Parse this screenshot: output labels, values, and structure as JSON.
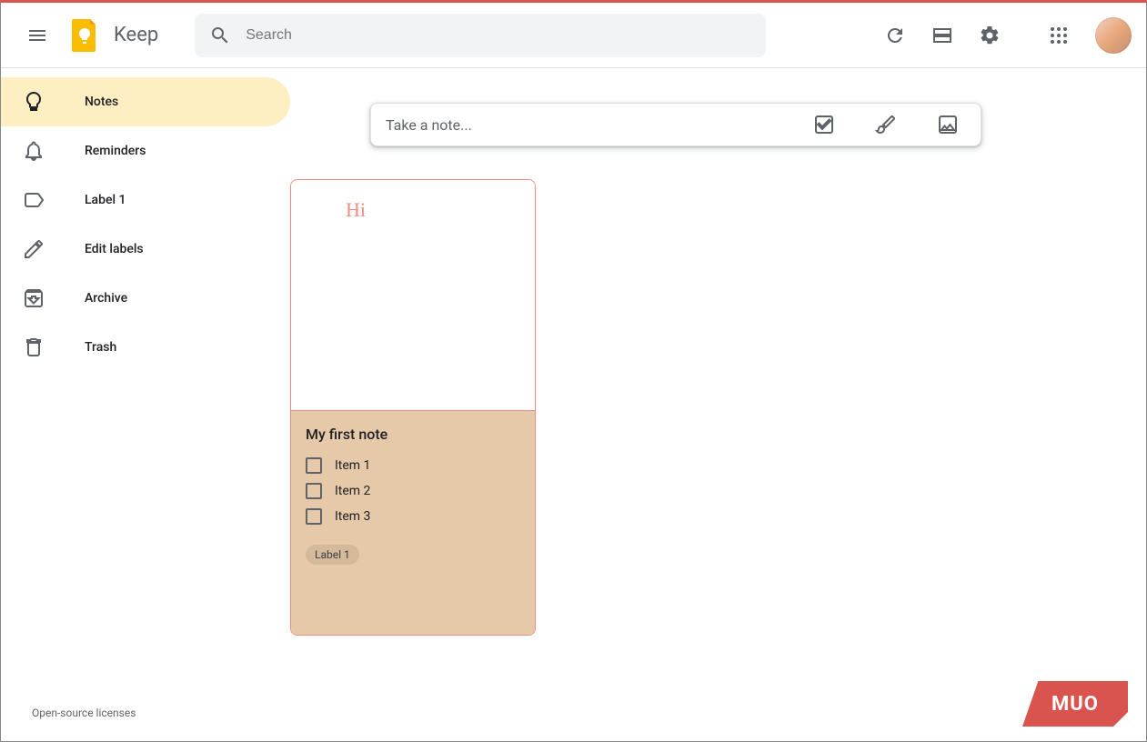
{
  "app": {
    "name": "Keep"
  },
  "search": {
    "placeholder": "Search"
  },
  "sidebar": {
    "items": [
      {
        "label": "Notes"
      },
      {
        "label": "Reminders"
      },
      {
        "label": "Label 1"
      },
      {
        "label": "Edit labels"
      },
      {
        "label": "Archive"
      },
      {
        "label": "Trash"
      }
    ]
  },
  "take_note": {
    "placeholder": "Take a note..."
  },
  "notes": [
    {
      "drawing_text": "Hi",
      "title": "My first note",
      "items": [
        "Item 1",
        "Item 2",
        "Item 3"
      ],
      "label": "Label 1",
      "color": "#e6c9a8"
    }
  ],
  "footer": {
    "licenses": "Open-source licenses"
  },
  "badge": {
    "text": "MUO"
  }
}
